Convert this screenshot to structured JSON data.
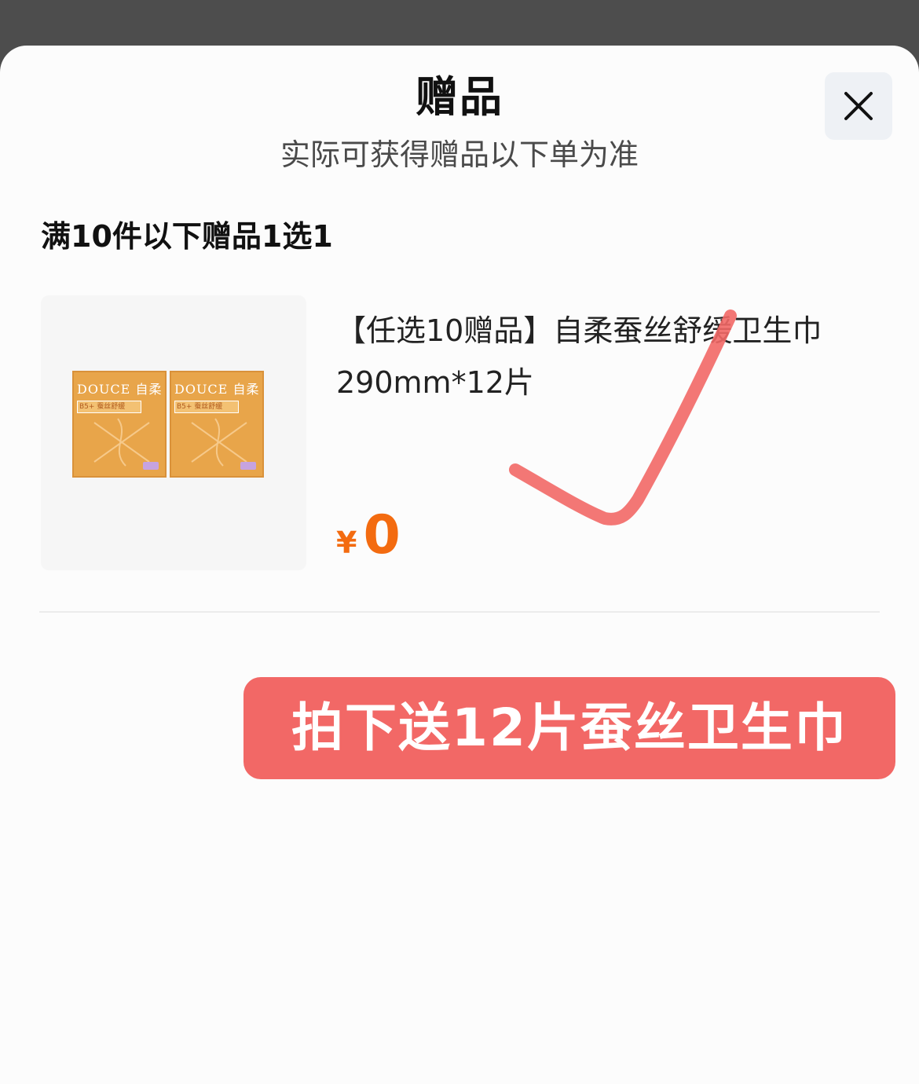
{
  "sheet": {
    "title": "赠品",
    "subtitle": "实际可获得赠品以下单为准",
    "close_icon": "close-icon"
  },
  "gift_group": {
    "rule_title": "满10件以下赠品1选1",
    "items": [
      {
        "name": "【任选10赠品】自柔蚕丝舒缓卫生巾290mm*12片",
        "currency": "¥",
        "price": "0",
        "image": {
          "brand_text": "DOUCE 自柔",
          "tag_text": "B5+ 蚕丝舒缓",
          "color": "#e8a54a"
        }
      }
    ]
  },
  "annotation": {
    "checkmark_color": "#f26866",
    "banner_text": "拍下送12片蚕丝卫生巾",
    "banner_color": "#f26866"
  },
  "colors": {
    "price": "#f36b10",
    "backdrop": "#4d4d4d"
  }
}
